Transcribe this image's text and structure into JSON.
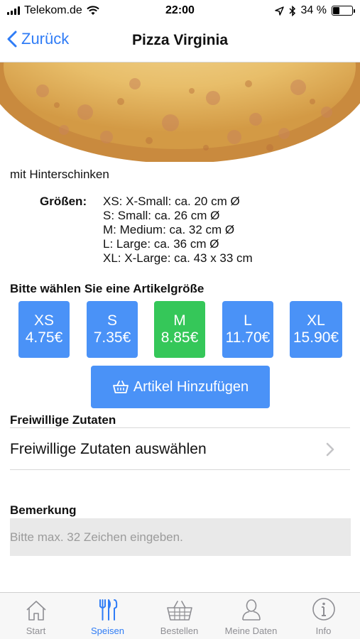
{
  "status_bar": {
    "carrier": "Telekom.de",
    "time": "22:00",
    "battery_percent": "34 %",
    "battery_level": 0.34
  },
  "nav": {
    "back_label": "Zurück",
    "title": "Pizza Virginia"
  },
  "product": {
    "description": "mit Hinterschinken",
    "sizes_label": "Größen:",
    "size_info": [
      "XS: X-Small: ca. 20 cm Ø",
      "S: Small: ca. 26 cm Ø",
      "M: Medium: ca. 32 cm Ø",
      "L: Large: ca. 36 cm Ø",
      "XL: X-Large: ca. 43 x 33 cm"
    ]
  },
  "size_selection": {
    "heading": "Bitte wählen Sie eine Artikelgröße",
    "options": [
      {
        "name": "XS",
        "price": "4.75€"
      },
      {
        "name": "S",
        "price": "7.35€"
      },
      {
        "name": "M",
        "price": "8.85€"
      },
      {
        "name": "L",
        "price": "11.70€"
      },
      {
        "name": "XL",
        "price": "15.90€"
      }
    ],
    "selected": "M",
    "add_button_label": "Artikel Hinzufügen"
  },
  "extras": {
    "heading": "Freiwillige Zutaten",
    "select_label": "Freiwillige Zutaten auswählen"
  },
  "remark": {
    "heading": "Bemerkung",
    "placeholder": "Bitte max. 32 Zeichen eingeben.",
    "value": ""
  },
  "tab_bar": {
    "items": [
      {
        "label": "Start",
        "icon": "home-icon"
      },
      {
        "label": "Speisen",
        "icon": "fork-knife-icon"
      },
      {
        "label": "Bestellen",
        "icon": "basket-icon"
      },
      {
        "label": "Meine Daten",
        "icon": "person-icon"
      },
      {
        "label": "Info",
        "icon": "info-icon"
      }
    ],
    "active": "Speisen"
  },
  "colors": {
    "accent": "#2f7cf6",
    "button_blue": "#4a92f7",
    "selected_green": "#35c759"
  }
}
